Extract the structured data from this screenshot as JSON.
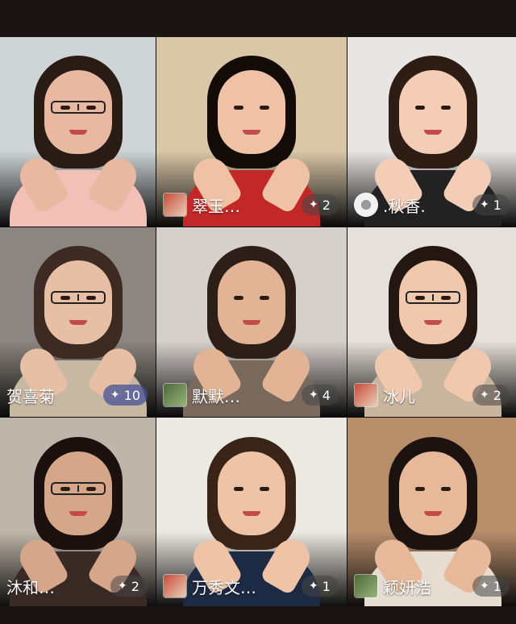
{
  "tiles": [
    {
      "name": "",
      "likes": "",
      "bg": "#cfd4d6",
      "skin": "#e8b9a0",
      "hair": "#2a1c15",
      "shirt": "#f3c0b8",
      "glasses": true,
      "avatar": "none"
    },
    {
      "name": "翠玉…",
      "likes": "2",
      "bg": "#d9c7a8",
      "skin": "#efc2a6",
      "hair": "#120b08",
      "shirt": "#c32828",
      "glasses": false,
      "avatar": "photo"
    },
    {
      "name": ".秋香.",
      "likes": "1",
      "bg": "#e8e6e4",
      "skin": "#f3cdb6",
      "hair": "#2e1d14",
      "shirt": "#222",
      "glasses": false,
      "avatar": "round"
    },
    {
      "name": "贺喜菊",
      "likes": "10",
      "bg": "#8c8680",
      "skin": "#e7bfa4",
      "hair": "#3d2a22",
      "shirt": "#c7b8a4",
      "glasses": true,
      "avatar": "none",
      "hot": true
    },
    {
      "name": "默默…",
      "likes": "4",
      "bg": "#d6d0cc",
      "skin": "#e2b394",
      "hair": "#2d1f18",
      "shirt": "#7a6a5e",
      "glasses": false,
      "avatar": "plant"
    },
    {
      "name": "冰儿",
      "likes": "2",
      "bg": "#e6e0da",
      "skin": "#f0c8ae",
      "hair": "#241712",
      "shirt": "#c9b49d",
      "glasses": true,
      "avatar": "photo"
    },
    {
      "name": "沐和…",
      "likes": "2",
      "bg": "#bfb5aa",
      "skin": "#d6a68a",
      "hair": "#1b1210",
      "shirt": "#3a2a26",
      "glasses": true,
      "avatar": "none"
    },
    {
      "name": "万秀文…",
      "likes": "1",
      "bg": "#ece8e2",
      "skin": "#efc3a6",
      "hair": "#3a2418",
      "shirt": "#1d2a44",
      "glasses": false,
      "avatar": "photo"
    },
    {
      "name": "颖妍浩",
      "likes": "1",
      "bg": "#b78d6a",
      "skin": "#e8b89a",
      "hair": "#1c1310",
      "shirt": "#e6ddd2",
      "glasses": false,
      "avatar": "plant"
    }
  ],
  "icons": {
    "like": "sparkle-icon"
  }
}
